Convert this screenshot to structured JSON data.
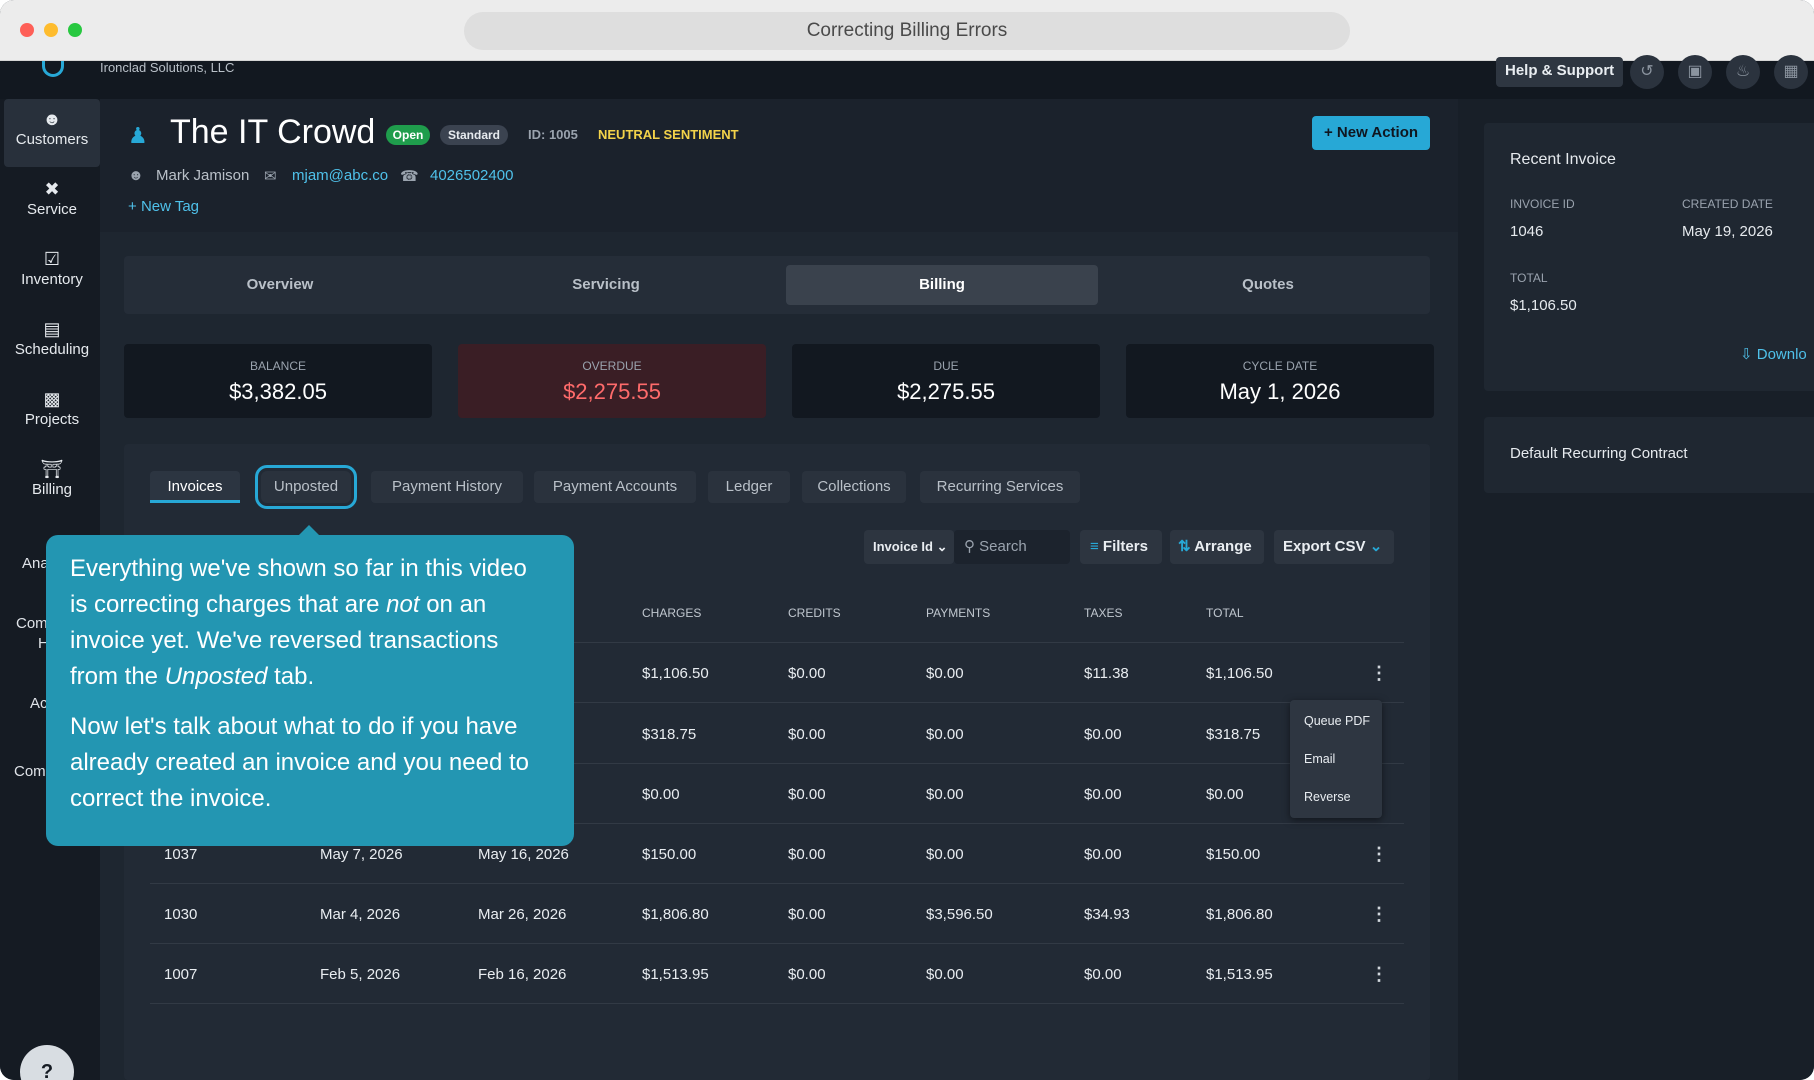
{
  "window": {
    "title": "Correcting Billing Errors"
  },
  "appbar": {
    "company": "Ironclad Solutions, LLC",
    "help_label": "Help & Support"
  },
  "sidebar": {
    "items": [
      {
        "label": "Customers",
        "icon": "users-icon"
      },
      {
        "label": "Service",
        "icon": "tools-icon"
      },
      {
        "label": "Inventory",
        "icon": "clipboard-icon"
      },
      {
        "label": "Scheduling",
        "icon": "calendar-icon"
      },
      {
        "label": "Projects",
        "icon": "hierarchy-icon"
      },
      {
        "label": "Billing",
        "icon": "bank-icon"
      }
    ],
    "fragments": [
      "Ana",
      "Com",
      "H",
      "Ac",
      "Com"
    ],
    "help_label": "?"
  },
  "customer": {
    "name": "The IT Crowd",
    "status": "Open",
    "tier": "Standard",
    "id_label": "ID: 1005",
    "sentiment": "NEUTRAL SENTIMENT",
    "contact_name": "Mark Jamison",
    "email": "mjam@abc.co",
    "phone": "4026502400",
    "new_tag_label": "New Tag",
    "new_action_label": "New Action"
  },
  "tabs": [
    "Overview",
    "Servicing",
    "Billing",
    "Quotes"
  ],
  "stats": {
    "balance": {
      "label": "BALANCE",
      "value": "$3,382.05"
    },
    "overdue": {
      "label": "OVERDUE",
      "value": "$2,275.55"
    },
    "due": {
      "label": "DUE",
      "value": "$2,275.55"
    },
    "cycle": {
      "label": "CYCLE DATE",
      "value": "May 1, 2026"
    }
  },
  "subtabs": [
    "Invoices",
    "Unposted",
    "Payment History",
    "Payment Accounts",
    "Ledger",
    "Collections",
    "Recurring Services"
  ],
  "controls": {
    "field_select": "Invoice Id",
    "search_placeholder": "Search",
    "filters": "Filters",
    "arrange": "Arrange",
    "export": "Export CSV"
  },
  "table": {
    "headers": [
      "CHARGES",
      "CREDITS",
      "PAYMENTS",
      "TAXES",
      "TOTAL"
    ],
    "rows": [
      {
        "id": "",
        "date": "",
        "due": "",
        "charges": "$1,106.50",
        "credits": "$0.00",
        "payments": "$0.00",
        "taxes": "$11.38",
        "total": "$1,106.50"
      },
      {
        "id": "",
        "date": "",
        "due": "",
        "charges": "$318.75",
        "credits": "$0.00",
        "payments": "$0.00",
        "taxes": "$0.00",
        "total": "$318.75"
      },
      {
        "id": "",
        "date": "",
        "due": "",
        "charges": "$0.00",
        "credits": "$0.00",
        "payments": "$0.00",
        "taxes": "$0.00",
        "total": "$0.00"
      },
      {
        "id": "1037",
        "date": "May 7, 2026",
        "due": "May 16, 2026",
        "charges": "$150.00",
        "credits": "$0.00",
        "payments": "$0.00",
        "taxes": "$0.00",
        "total": "$150.00"
      },
      {
        "id": "1030",
        "date": "Mar 4, 2026",
        "due": "Mar 26, 2026",
        "charges": "$1,806.80",
        "credits": "$0.00",
        "payments": "$3,596.50",
        "taxes": "$34.93",
        "total": "$1,806.80"
      },
      {
        "id": "1007",
        "date": "Feb 5, 2026",
        "due": "Feb 16, 2026",
        "charges": "$1,513.95",
        "credits": "$0.00",
        "payments": "$0.00",
        "taxes": "$0.00",
        "total": "$1,513.95"
      }
    ]
  },
  "row_menu": [
    "Queue PDF",
    "Email",
    "Reverse"
  ],
  "recent_invoice": {
    "title": "Recent Invoice",
    "invoice_id_label": "INVOICE ID",
    "invoice_id": "1046",
    "created_label": "CREATED DATE",
    "created": "May 19, 2026",
    "total_label": "TOTAL",
    "total": "$1,106.50",
    "download_label": "Downlo"
  },
  "recurring": {
    "title": "Default Recurring Contract"
  },
  "callout": {
    "p1_a": "Everything we've shown so far in this video is correcting charges that are ",
    "p1_em1": "not",
    "p1_b": " on an invoice yet. We've reversed transactions from the ",
    "p1_em2": "Unposted",
    "p1_c": " tab.",
    "p2": "Now let's talk about what to do if you have already created an invoice and you need to correct the invoice."
  },
  "colors": {
    "accent": "#27a8d6",
    "overdue": "#ff6b6b",
    "callout": "#2396b2",
    "open_badge": "#1f9d4c",
    "sentiment": "#f3d34a"
  }
}
